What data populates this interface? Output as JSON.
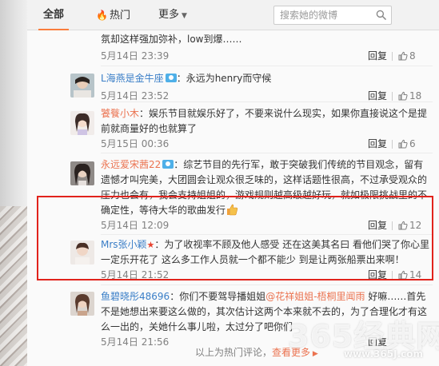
{
  "tabs": {
    "all": "全部",
    "hot": "热门",
    "more": "更多"
  },
  "search": {
    "placeholder": "搜索她的微博"
  },
  "comments": [
    {
      "text": "氛却这样强加弥补，low到爆……",
      "time": "5月14日 23:39",
      "reply": "回复",
      "likes": "8"
    },
    {
      "user": "L海燕是金牛座",
      "text": "：永远为henry而守候",
      "time": "5月14日 23:52",
      "reply": "回复",
      "likes": "18"
    },
    {
      "user": "饕餮小木",
      "text": "：娱乐节目就娱乐好了，不要来说什么现实，如果你直接说这个是提前就商量好的也就算了",
      "time": "5月15日 00:36",
      "reply": "回复",
      "likes": "6"
    },
    {
      "user": "永远爱宋茜22",
      "text": "：综艺节目的先行军，敢于突破我们传统的节目观念，留有遗憾才叫完美，大团圆会让观众很乏味的，这样话题性很高，不过承受观众的压力也会有，我会支持姐姐的，游戏规则越高级越好玩，就如极限挑战里的不确定性，等待大华的歌曲发行",
      "time": "5月14日 12:09",
      "reply": "回复",
      "likes": "12"
    },
    {
      "user": "Mrs张小颖",
      "text": "：为了收视率不顾及他人感受 还在这美其名曰 看他们哭了你心里一定乐开花了 这么多工作人员就一个都不能少 到是让两张船票出来啊！",
      "time": "5月14日 21:52",
      "reply": "回复",
      "likes": "14"
    },
    {
      "user": "鱼碧晓彤48696",
      "mention": "@花祥姐姐-梧桐里闻雨",
      "text_pre": "：你们不要驾导播姐姐",
      "text_post": " 好嘛……首先不是她想出来要这么做的，其次估计这两个本来就不去的，为了合理化才有这么一出的，关她什么事儿啦，太过分了吧你们",
      "time": "5月14日 21:56",
      "reply": "回复"
    }
  ],
  "footer": {
    "text": "以上为热门评论，",
    "more": "查看更多"
  },
  "watermark": {
    "brand": "365经典网",
    "url": "www.365J.com"
  }
}
